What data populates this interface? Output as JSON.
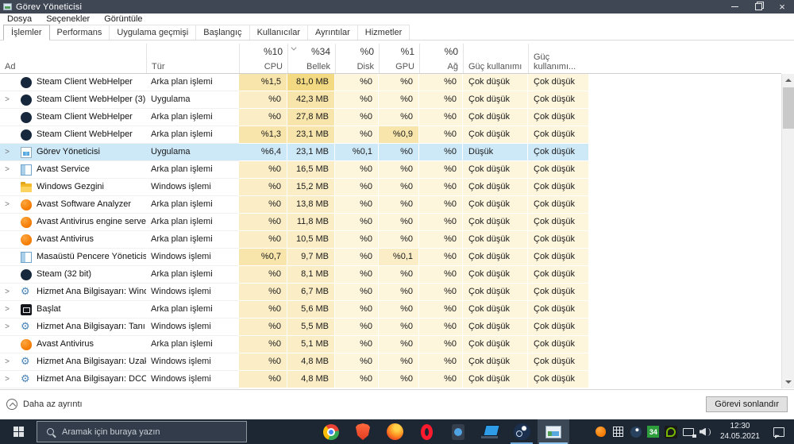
{
  "window": {
    "title": "Görev Yöneticisi",
    "menu": [
      "Dosya",
      "Seçenekler",
      "Görüntüle"
    ],
    "tabs": [
      "İşlemler",
      "Performans",
      "Uygulama geçmişi",
      "Başlangıç",
      "Kullanıcılar",
      "Ayrıntılar",
      "Hizmetler"
    ],
    "active_tab": "İşlemler",
    "controls": [
      "minimize",
      "maximize",
      "close"
    ]
  },
  "columns": [
    {
      "id": "ad",
      "label": "Ad",
      "value": "",
      "numeric": false,
      "sorted": false
    },
    {
      "id": "tur",
      "label": "Tür",
      "value": "",
      "numeric": false,
      "sorted": false
    },
    {
      "id": "cpu",
      "label": "CPU",
      "value": "%10",
      "numeric": true,
      "sorted": false
    },
    {
      "id": "mem",
      "label": "Bellek",
      "value": "%34",
      "numeric": true,
      "sorted": true
    },
    {
      "id": "disk",
      "label": "Disk",
      "value": "%0",
      "numeric": true,
      "sorted": false
    },
    {
      "id": "gpu",
      "label": "GPU",
      "value": "%1",
      "numeric": true,
      "sorted": false
    },
    {
      "id": "net",
      "label": "Ağ",
      "value": "%0",
      "numeric": true,
      "sorted": false
    },
    {
      "id": "power",
      "label": "Güç kullanımı",
      "value": "",
      "numeric": false,
      "sorted": false
    },
    {
      "id": "ptrend",
      "label": "Güç kullanımı...",
      "value": "",
      "numeric": false,
      "sorted": false
    }
  ],
  "rows": [
    {
      "name": "Steam Client WebHelper",
      "icon": "steam",
      "chevron": false,
      "type": "Arka plan işlemi",
      "cpu": "%1,5",
      "mem": "81,0 MB",
      "disk": "%0",
      "gpu": "%0",
      "net": "%0",
      "power": "Çok düşük",
      "ptrend": "Çok düşük",
      "selected": false,
      "heat": {
        "cpu": 2,
        "mem": 3,
        "disk": 0,
        "gpu": 0,
        "net": 0
      }
    },
    {
      "name": "Steam Client WebHelper (3)",
      "icon": "steam",
      "chevron": true,
      "type": "Uygulama",
      "cpu": "%0",
      "mem": "42,3 MB",
      "disk": "%0",
      "gpu": "%0",
      "net": "%0",
      "power": "Çok düşük",
      "ptrend": "Çok düşük",
      "selected": false,
      "heat": {
        "cpu": 1,
        "mem": 2,
        "disk": 0,
        "gpu": 0,
        "net": 0
      }
    },
    {
      "name": "Steam Client WebHelper",
      "icon": "steam",
      "chevron": false,
      "type": "Arka plan işlemi",
      "cpu": "%0",
      "mem": "27,8 MB",
      "disk": "%0",
      "gpu": "%0",
      "net": "%0",
      "power": "Çok düşük",
      "ptrend": "Çok düşük",
      "selected": false,
      "heat": {
        "cpu": 1,
        "mem": 2,
        "disk": 0,
        "gpu": 0,
        "net": 0
      }
    },
    {
      "name": "Steam Client WebHelper",
      "icon": "steam",
      "chevron": false,
      "type": "Arka plan işlemi",
      "cpu": "%1,3",
      "mem": "23,1 MB",
      "disk": "%0",
      "gpu": "%0,9",
      "net": "%0",
      "power": "Çok düşük",
      "ptrend": "Çok düşük",
      "selected": false,
      "heat": {
        "cpu": 2,
        "mem": 2,
        "disk": 0,
        "gpu": 2,
        "net": 0
      }
    },
    {
      "name": "Görev Yöneticisi",
      "icon": "taskmgr",
      "chevron": true,
      "type": "Uygulama",
      "cpu": "%6,4",
      "mem": "23,1 MB",
      "disk": "%0,1",
      "gpu": "%0",
      "net": "%0",
      "power": "Düşük",
      "ptrend": "Çok düşük",
      "selected": true,
      "heat": {
        "cpu": 3,
        "mem": 2,
        "disk": 1,
        "gpu": 0,
        "net": 0
      }
    },
    {
      "name": "Avast Service",
      "icon": "winapp",
      "chevron": true,
      "type": "Arka plan işlemi",
      "cpu": "%0",
      "mem": "16,5 MB",
      "disk": "%0",
      "gpu": "%0",
      "net": "%0",
      "power": "Çok düşük",
      "ptrend": "Çok düşük",
      "selected": false,
      "heat": {
        "cpu": 1,
        "mem": 1,
        "disk": 0,
        "gpu": 0,
        "net": 0
      }
    },
    {
      "name": "Windows Gezgini",
      "icon": "folder",
      "chevron": false,
      "type": "Windows işlemi",
      "cpu": "%0",
      "mem": "15,2 MB",
      "disk": "%0",
      "gpu": "%0",
      "net": "%0",
      "power": "Çok düşük",
      "ptrend": "Çok düşük",
      "selected": false,
      "heat": {
        "cpu": 1,
        "mem": 1,
        "disk": 0,
        "gpu": 0,
        "net": 0
      }
    },
    {
      "name": "Avast Software Analyzer",
      "icon": "avast",
      "chevron": true,
      "type": "Arka plan işlemi",
      "cpu": "%0",
      "mem": "13,8 MB",
      "disk": "%0",
      "gpu": "%0",
      "net": "%0",
      "power": "Çok düşük",
      "ptrend": "Çok düşük",
      "selected": false,
      "heat": {
        "cpu": 1,
        "mem": 1,
        "disk": 0,
        "gpu": 0,
        "net": 0
      }
    },
    {
      "name": "Avast Antivirus engine server",
      "icon": "avast",
      "chevron": false,
      "type": "Arka plan işlemi",
      "cpu": "%0",
      "mem": "11,8 MB",
      "disk": "%0",
      "gpu": "%0",
      "net": "%0",
      "power": "Çok düşük",
      "ptrend": "Çok düşük",
      "selected": false,
      "heat": {
        "cpu": 1,
        "mem": 1,
        "disk": 0,
        "gpu": 0,
        "net": 0
      }
    },
    {
      "name": "Avast Antivirus",
      "icon": "avast",
      "chevron": false,
      "type": "Arka plan işlemi",
      "cpu": "%0",
      "mem": "10,5 MB",
      "disk": "%0",
      "gpu": "%0",
      "net": "%0",
      "power": "Çok düşük",
      "ptrend": "Çok düşük",
      "selected": false,
      "heat": {
        "cpu": 1,
        "mem": 1,
        "disk": 0,
        "gpu": 0,
        "net": 0
      }
    },
    {
      "name": "Masaüstü Pencere Yöneticisi",
      "icon": "winapp",
      "chevron": false,
      "type": "Windows işlemi",
      "cpu": "%0,7",
      "mem": "9,7 MB",
      "disk": "%0",
      "gpu": "%0,1",
      "net": "%0",
      "power": "Çok düşük",
      "ptrend": "Çok düşük",
      "selected": false,
      "heat": {
        "cpu": 2,
        "mem": 1,
        "disk": 0,
        "gpu": 1,
        "net": 0
      }
    },
    {
      "name": "Steam (32 bit)",
      "icon": "steam",
      "chevron": false,
      "type": "Arka plan işlemi",
      "cpu": "%0",
      "mem": "8,1 MB",
      "disk": "%0",
      "gpu": "%0",
      "net": "%0",
      "power": "Çok düşük",
      "ptrend": "Çok düşük",
      "selected": false,
      "heat": {
        "cpu": 1,
        "mem": 1,
        "disk": 0,
        "gpu": 0,
        "net": 0
      }
    },
    {
      "name": "Hizmet Ana Bilgisayarı: Window...",
      "icon": "gear",
      "chevron": true,
      "type": "Windows işlemi",
      "cpu": "%0",
      "mem": "6,7 MB",
      "disk": "%0",
      "gpu": "%0",
      "net": "%0",
      "power": "Çok düşük",
      "ptrend": "Çok düşük",
      "selected": false,
      "heat": {
        "cpu": 1,
        "mem": 1,
        "disk": 0,
        "gpu": 0,
        "net": 0
      }
    },
    {
      "name": "Başlat",
      "icon": "start",
      "chevron": true,
      "type": "Arka plan işlemi",
      "cpu": "%0",
      "mem": "5,6 MB",
      "disk": "%0",
      "gpu": "%0",
      "net": "%0",
      "power": "Çok düşük",
      "ptrend": "Çok düşük",
      "selected": false,
      "heat": {
        "cpu": 1,
        "mem": 1,
        "disk": 0,
        "gpu": 0,
        "net": 0
      }
    },
    {
      "name": "Hizmet Ana Bilgisayarı: Tanı İlke...",
      "icon": "gear",
      "chevron": true,
      "type": "Windows işlemi",
      "cpu": "%0",
      "mem": "5,5 MB",
      "disk": "%0",
      "gpu": "%0",
      "net": "%0",
      "power": "Çok düşük",
      "ptrend": "Çok düşük",
      "selected": false,
      "heat": {
        "cpu": 1,
        "mem": 1,
        "disk": 0,
        "gpu": 0,
        "net": 0
      }
    },
    {
      "name": "Avast Antivirus",
      "icon": "avast",
      "chevron": false,
      "type": "Arka plan işlemi",
      "cpu": "%0",
      "mem": "5,1 MB",
      "disk": "%0",
      "gpu": "%0",
      "net": "%0",
      "power": "Çok düşük",
      "ptrend": "Çok düşük",
      "selected": false,
      "heat": {
        "cpu": 1,
        "mem": 1,
        "disk": 0,
        "gpu": 0,
        "net": 0
      }
    },
    {
      "name": "Hizmet Ana Bilgisayarı: Uzaktan ...",
      "icon": "gear",
      "chevron": true,
      "type": "Windows işlemi",
      "cpu": "%0",
      "mem": "4,8 MB",
      "disk": "%0",
      "gpu": "%0",
      "net": "%0",
      "power": "Çok düşük",
      "ptrend": "Çok düşük",
      "selected": false,
      "heat": {
        "cpu": 1,
        "mem": 1,
        "disk": 0,
        "gpu": 0,
        "net": 0
      }
    },
    {
      "name": "Hizmet Ana Bilgisayarı: DCOM S...",
      "icon": "gear",
      "chevron": true,
      "type": "Windows işlemi",
      "cpu": "%0",
      "mem": "4,8 MB",
      "disk": "%0",
      "gpu": "%0",
      "net": "%0",
      "power": "Çok düşük",
      "ptrend": "Çok düşük",
      "selected": false,
      "heat": {
        "cpu": 1,
        "mem": 1,
        "disk": 0,
        "gpu": 0,
        "net": 0
      }
    }
  ],
  "footer": {
    "less_details": "Daha az ayrıntı",
    "end_task": "Görevi sonlandır"
  },
  "taskbar": {
    "search_placeholder": "Aramak için buraya yazın",
    "apps": [
      {
        "id": "chrome",
        "state": ""
      },
      {
        "id": "brave",
        "state": ""
      },
      {
        "id": "firefox",
        "state": ""
      },
      {
        "id": "opera",
        "state": ""
      },
      {
        "id": "genericapp",
        "state": ""
      },
      {
        "id": "laptop",
        "state": ""
      },
      {
        "id": "steam",
        "state": "running"
      },
      {
        "id": "taskmgr",
        "state": "active running"
      }
    ],
    "tray": [
      "avast",
      "grid",
      "steam",
      "temp",
      "nvidia",
      "display",
      "volume"
    ],
    "temp_badge": "34",
    "clock": {
      "time": "12:30",
      "date": "24.05.2021"
    }
  },
  "colors": {
    "selection": "#cde8f7",
    "heat": [
      "#fdf5dc",
      "#fbeec7",
      "#f8e5ab",
      "#f3d981"
    ],
    "titlebar": "#404754",
    "taskbar": "#1d2633"
  }
}
